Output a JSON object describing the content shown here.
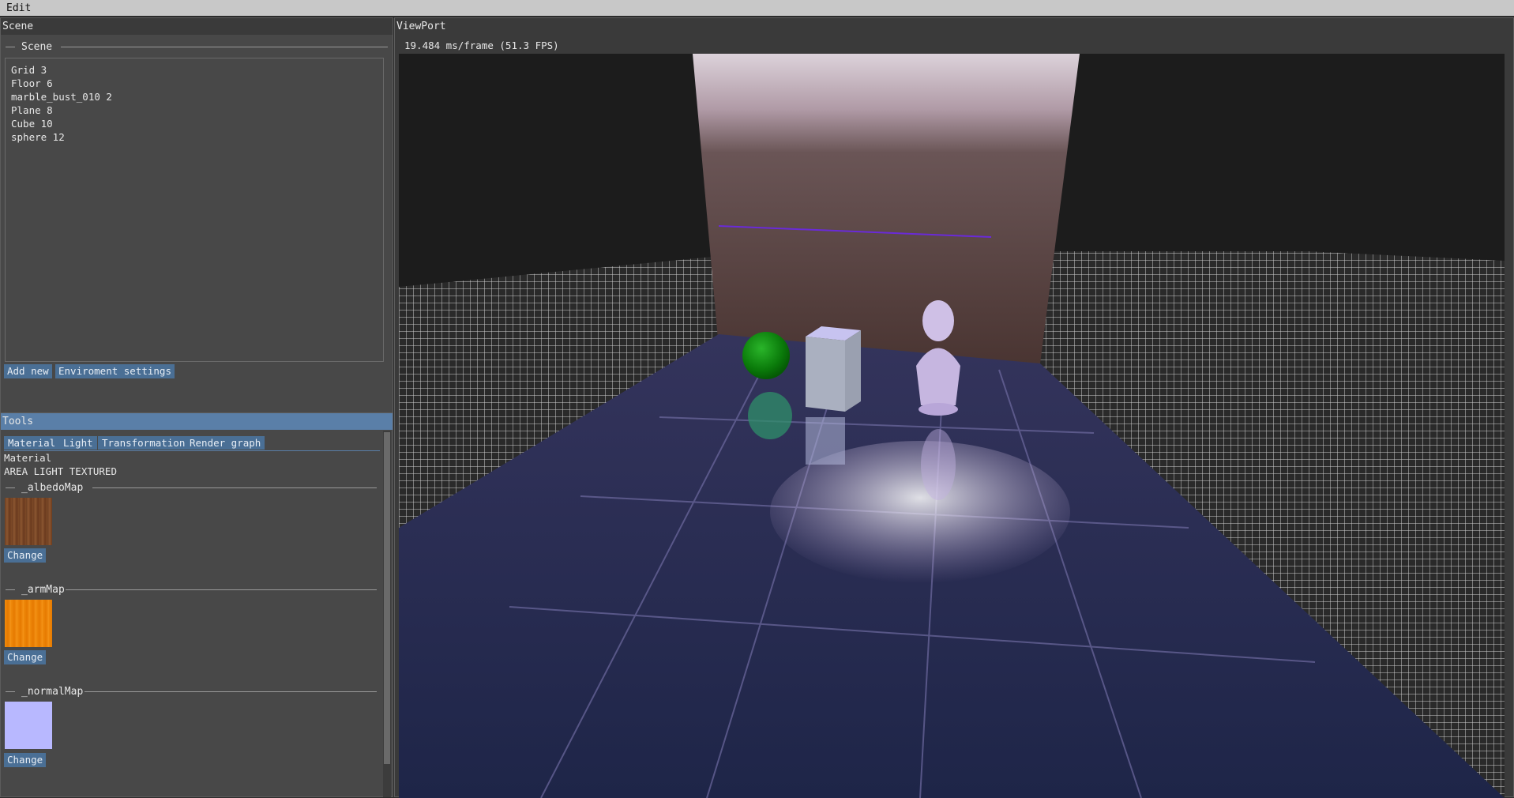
{
  "menubar": {
    "edit_label": "Edit"
  },
  "scene_window": {
    "title": "Scene",
    "section_label": "Scene",
    "items": [
      "Grid 3",
      "Floor 6",
      "marble_bust_010 2",
      "Plane 8",
      "Cube 10",
      "sphere 12"
    ],
    "add_new_label": "Add new",
    "env_settings_label": "Enviroment settings"
  },
  "tools_window": {
    "title": "Tools",
    "tabs": [
      "Material",
      "Light",
      "Transformation",
      "Render graph"
    ],
    "material_label": "Material",
    "material_name": "AREA LIGHT TEXTURED",
    "maps": [
      {
        "label": "_albedoMap",
        "button": "Change",
        "color": "#7a4a28"
      },
      {
        "label": "_armMap",
        "button": "Change",
        "color": "#f08a0c"
      },
      {
        "label": "_normalMap",
        "button": "Change",
        "color": "#b8b8ff"
      }
    ]
  },
  "viewport_window": {
    "title": "ViewPort",
    "fps_text": "19.484 ms/frame (51.3 FPS)"
  }
}
